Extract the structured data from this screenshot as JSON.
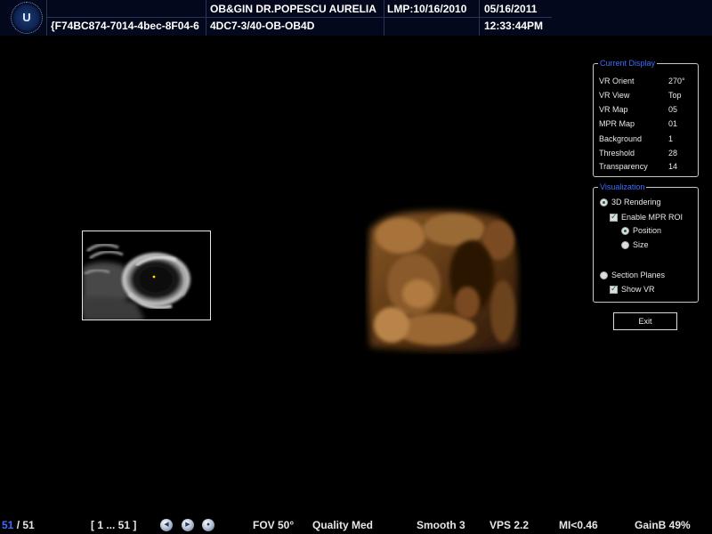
{
  "header": {
    "logo_letter": "U",
    "exam_id": "{F74BC874-7014-4bec-8F04-6",
    "institution": "OB&GIN DR.POPESCU AURELIA",
    "study": "4DC7-3/40-OB-OB4D",
    "lmp": "LMP:10/16/2010",
    "date": "05/16/2011",
    "time": "12:33:44PM"
  },
  "current_display": {
    "title": "Current Display",
    "rows": [
      {
        "label": "VR Orient",
        "value": "270°"
      },
      {
        "label": "VR View",
        "value": "Top"
      },
      {
        "label": "VR Map",
        "value": "05"
      },
      {
        "label": "MPR Map",
        "value": "01"
      },
      {
        "label": "Background",
        "value": "1"
      },
      {
        "label": "Threshold",
        "value": "28"
      },
      {
        "label": "Transparency",
        "value": "14"
      }
    ]
  },
  "visualization": {
    "title": "Visualization",
    "rendering_3d": "3D Rendering",
    "enable_mpr_roi": "Enable MPR ROI",
    "position": "Position",
    "size": "Size",
    "section_planes": "Section Planes",
    "show_vr": "Show VR"
  },
  "exit_label": "Exit",
  "footer": {
    "frame_current": "51",
    "frame_sep": " / ",
    "frame_total": "51",
    "range": "[ 1 ... 51 ]",
    "fov": "FOV 50°",
    "quality": "Quality Med",
    "smooth": "Smooth 3",
    "vps": "VPS 2.2",
    "mi": "MI<0.46",
    "gain": "GainB 49%"
  },
  "colors": {
    "accent": "#3c6cff",
    "header_bg": "#04081c",
    "frame_current": "#3c6cff"
  }
}
